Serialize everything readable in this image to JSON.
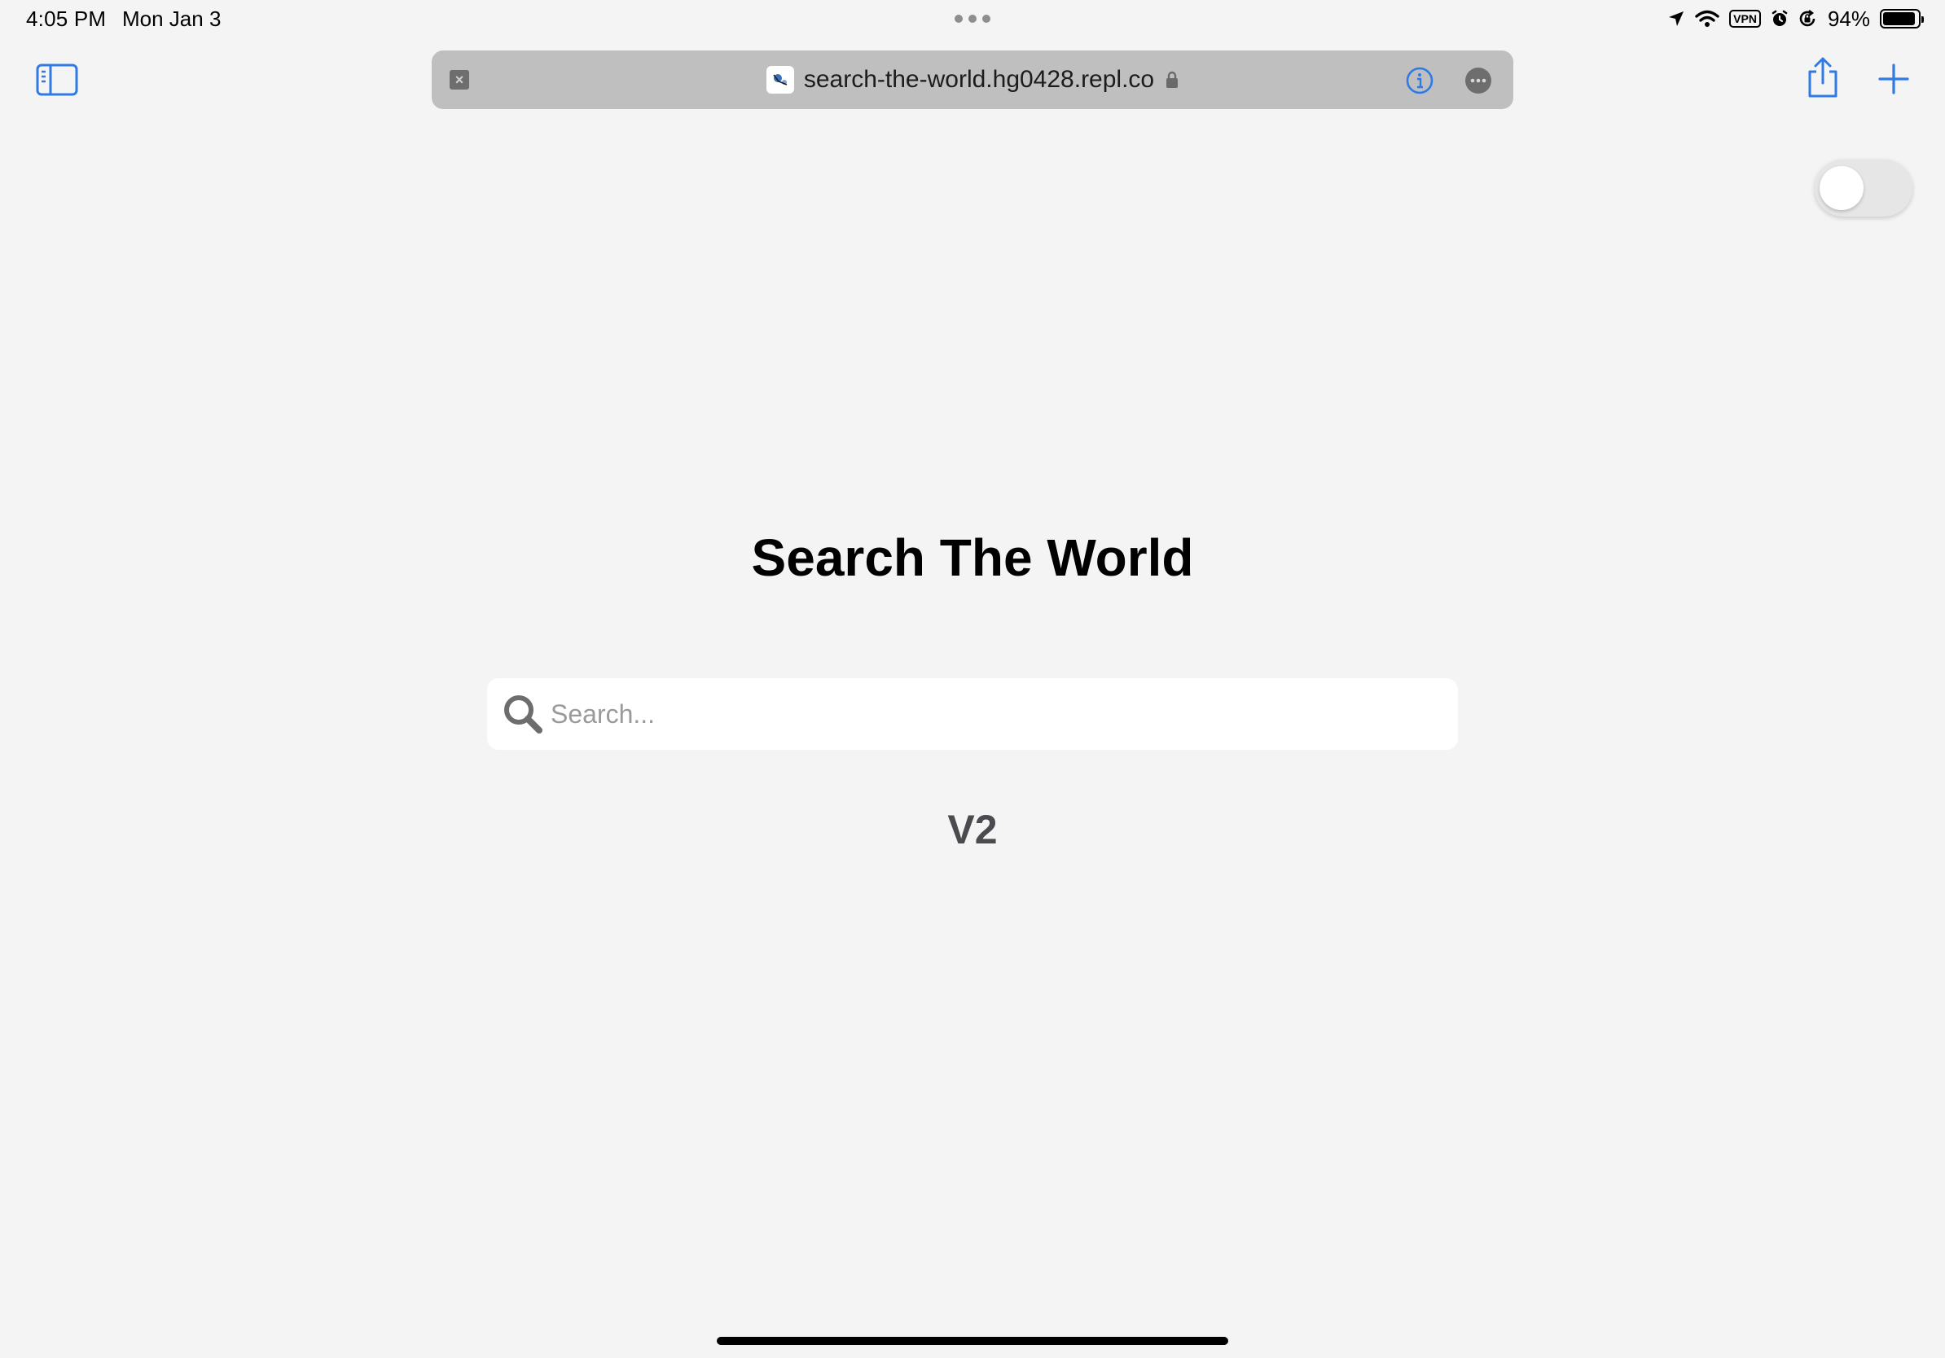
{
  "status_bar": {
    "time": "4:05 PM",
    "date": "Mon Jan 3",
    "vpn": "VPN",
    "battery_percent": "94%",
    "battery_level": 0.94,
    "icons": [
      "location-arrow-icon",
      "wifi-icon",
      "vpn-icon",
      "alarm-icon",
      "orientation-lock-icon",
      "battery-icon"
    ]
  },
  "browser": {
    "url": "search-the-world.hg0428.repl.co",
    "accent_color": "#2f7ae5",
    "icons": {
      "sidebar": "sidebar-icon",
      "close": "close-tab-icon",
      "favicon": "site-favicon",
      "lock": "lock-icon",
      "info": "info-icon",
      "more": "more-icon",
      "share": "share-icon",
      "new_tab": "plus-icon"
    }
  },
  "page": {
    "title": "Search The World",
    "search": {
      "placeholder": "Search...",
      "value": ""
    },
    "version": "V2",
    "toggle": {
      "on": false
    }
  }
}
